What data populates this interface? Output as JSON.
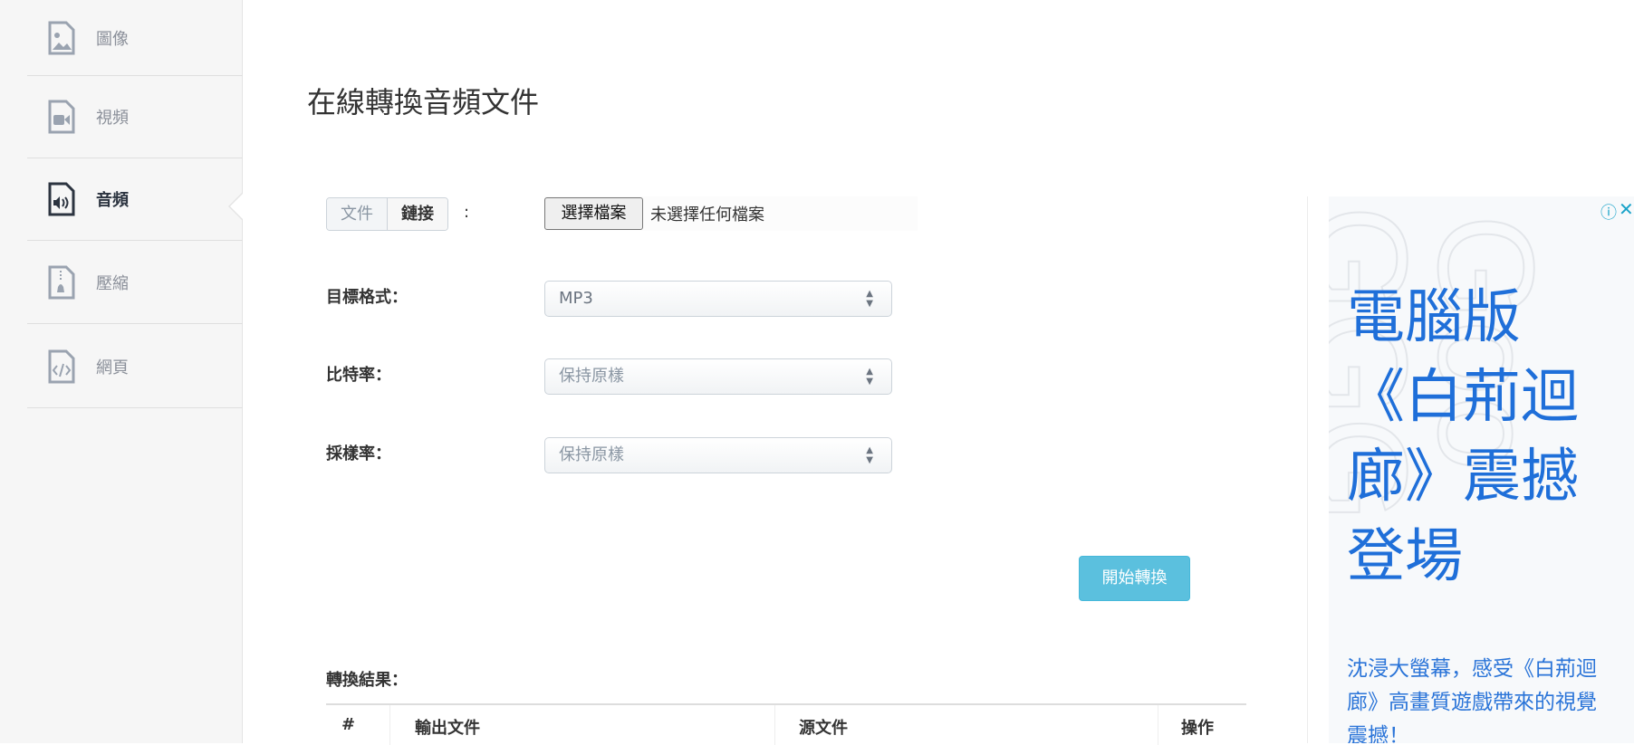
{
  "sidebar": {
    "items": [
      {
        "label": "圖像",
        "icon": "image-file-icon",
        "active": false
      },
      {
        "label": "視頻",
        "icon": "video-file-icon",
        "active": false
      },
      {
        "label": "音頻",
        "icon": "audio-file-icon",
        "active": true
      },
      {
        "label": "壓縮",
        "icon": "zip-file-icon",
        "active": false
      },
      {
        "label": "網頁",
        "icon": "code-file-icon",
        "active": false
      }
    ]
  },
  "main": {
    "title": "在線轉換音頻文件",
    "source_tabs": [
      "文件",
      "鏈接"
    ],
    "colon": ":",
    "file_button": "選擇檔案",
    "file_status": "未選擇任何檔案",
    "format_label": "目標格式：",
    "format_value": "MP3",
    "bitrate_label": "比特率：",
    "bitrate_value": "保持原樣",
    "samplerate_label": "採樣率：",
    "samplerate_value": "保持原樣",
    "convert_button": "開始轉換",
    "results_title": "轉換結果：",
    "table_headers": [
      "#",
      "輸出文件",
      "源文件",
      "操作"
    ]
  },
  "ad": {
    "headline": "電腦版《白荊迴廊》震撼登場",
    "body": "沈浸大螢幕，感受《白荊迴廊》高畫質遊戲帶來的視覺震撼！",
    "info_icon": "ⓘ",
    "close_icon": "✕",
    "color": "#1f6fd9"
  }
}
